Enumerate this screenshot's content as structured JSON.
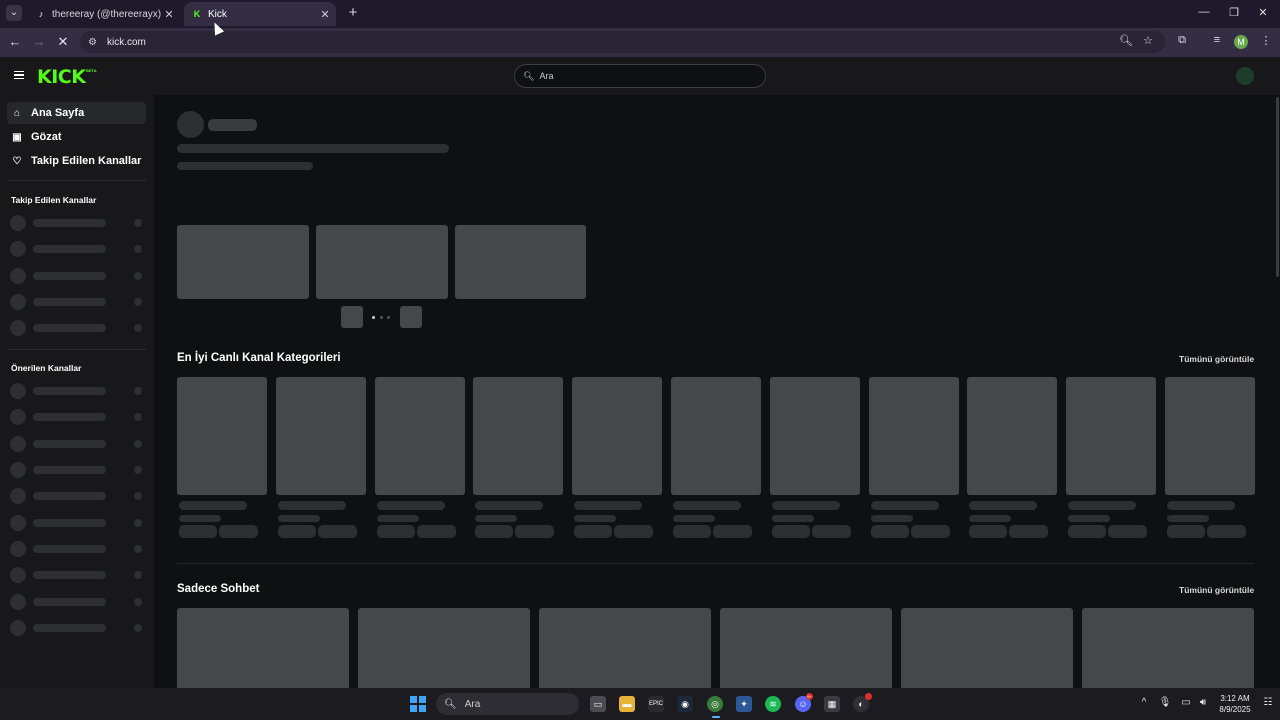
{
  "browser": {
    "tabs": [
      {
        "title": "thereeray (@thereerayx) CANLI",
        "favicon": "tiktok-icon",
        "active": false
      },
      {
        "title": "Kick",
        "favicon": "kick-icon",
        "active": true
      }
    ],
    "new_tab_label": "+",
    "url": "kick.com",
    "profile_initial": "M"
  },
  "site": {
    "logo_text": "KICK",
    "logo_badge": "BETA",
    "search_placeholder": "Ara",
    "nav": [
      {
        "label": "Ana Sayfa",
        "icon": "home-icon",
        "active": true
      },
      {
        "label": "Gözat",
        "icon": "browse-icon",
        "active": false
      },
      {
        "label": "Takip Edilen Kanallar",
        "icon": "heart-icon",
        "active": false
      }
    ],
    "sidebar_sections": {
      "followed": "Takip Edilen Kanallar",
      "recommended": "Önerilen Kanallar"
    },
    "sections": [
      {
        "title": "En İyi Canlı Kanal Kategorileri",
        "view_all": "Tümünü görüntüle"
      },
      {
        "title": "Sadece Sohbet",
        "view_all": "Tümünü görüntüle"
      }
    ]
  },
  "taskbar": {
    "search_placeholder": "Ara",
    "time": "3:12 AM",
    "date": "8/9/2025",
    "discord_badge": "9+"
  },
  "colors": {
    "kick_green": "#53fc18",
    "chrome_frame": "#1f1a2b",
    "chrome_toolbar": "#342d44",
    "site_bg": "#0f1011",
    "sidebar_bg": "#18181b"
  }
}
